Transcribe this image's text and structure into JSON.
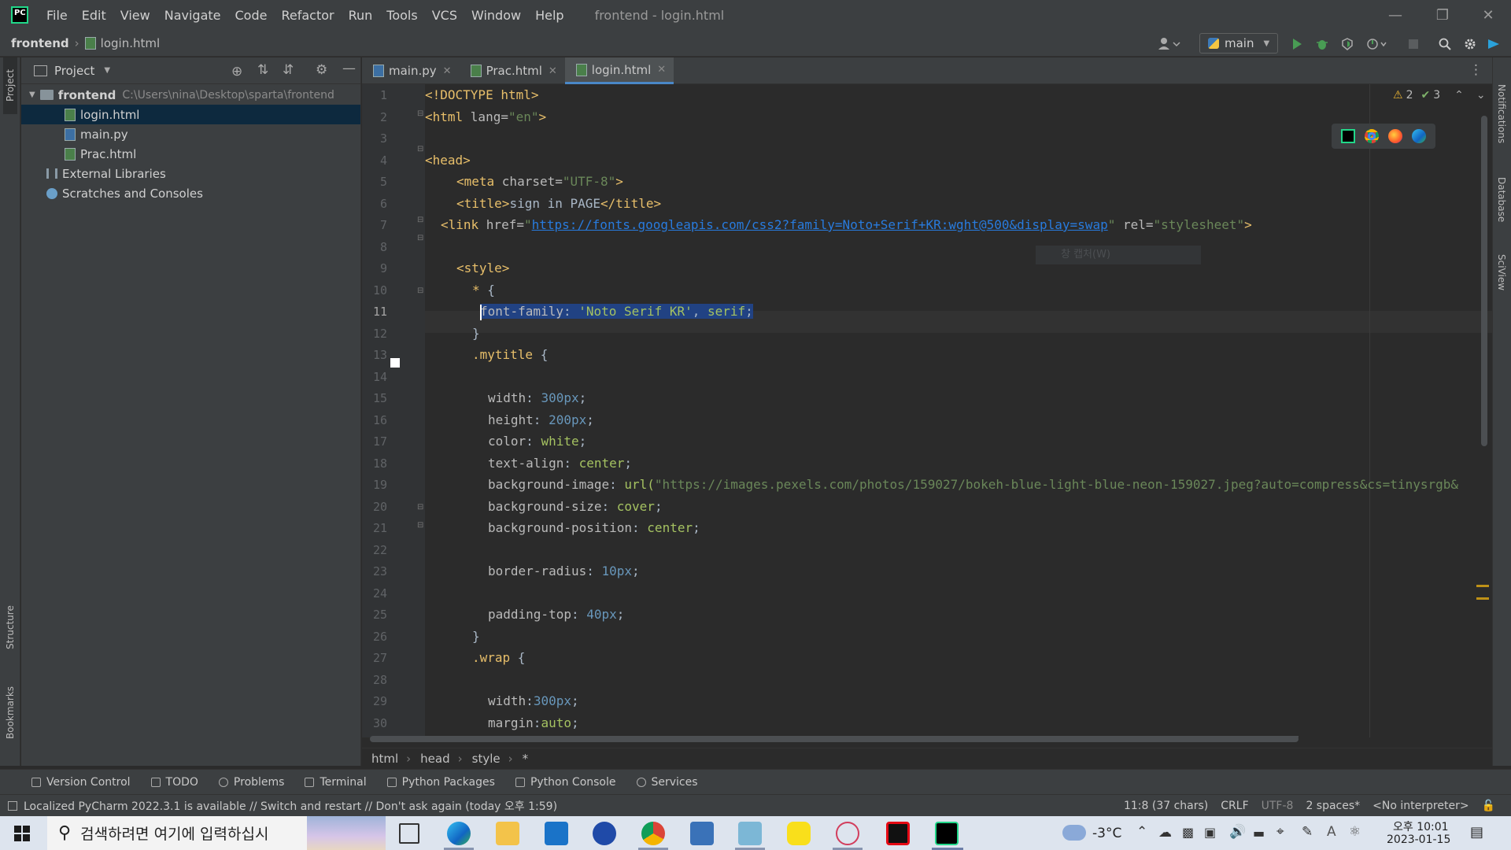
{
  "menubar": {
    "logo_text": "PC",
    "items": [
      "File",
      "Edit",
      "View",
      "Navigate",
      "Code",
      "Refactor",
      "Run",
      "Tools",
      "VCS",
      "Window",
      "Help"
    ],
    "window_title": "frontend - login.html"
  },
  "navbar": {
    "project": "frontend",
    "file": "login.html",
    "run_config": "main"
  },
  "project_panel": {
    "title": "Project",
    "tree": [
      {
        "label": "frontend",
        "hint": "C:\\Users\\nina\\Desktop\\sparta\\frontend",
        "type": "folder",
        "indent": 0
      },
      {
        "label": "login.html",
        "type": "html",
        "indent": 2
      },
      {
        "label": "main.py",
        "type": "py",
        "indent": 2
      },
      {
        "label": "Prac.html",
        "type": "html",
        "indent": 2
      },
      {
        "label": "External Libraries",
        "type": "lib",
        "indent": 1
      },
      {
        "label": "Scratches and Consoles",
        "type": "scratch",
        "indent": 1
      }
    ]
  },
  "tabs": [
    {
      "label": "main.py",
      "type": "py",
      "active": false
    },
    {
      "label": "Prac.html",
      "type": "html",
      "active": false
    },
    {
      "label": "login.html",
      "type": "html",
      "active": true
    }
  ],
  "editor": {
    "warnings": "2",
    "weak_warnings": "3",
    "current_line": 11,
    "line_numbers": [
      "1",
      "2",
      "3",
      "4",
      "5",
      "6",
      "7",
      "8",
      "9",
      "10",
      "11",
      "12",
      "13",
      "14",
      "15",
      "16",
      "17",
      "18",
      "19",
      "20",
      "21",
      "22",
      "23",
      "24",
      "25",
      "26",
      "27",
      "28",
      "29",
      "30"
    ],
    "overlay_hint": "창 캡처(W)"
  },
  "breadcrumbs": [
    "html",
    "head",
    "style",
    "*"
  ],
  "tool_windows": [
    "Version Control",
    "TODO",
    "Problems",
    "Terminal",
    "Python Packages",
    "Python Console",
    "Services"
  ],
  "left_strip": [
    "Project",
    "Structure",
    "Bookmarks"
  ],
  "right_strip": [
    "Notifications",
    "Database",
    "SciView"
  ],
  "status": {
    "message": "Localized PyCharm 2022.3.1 is available // Switch and restart // Don't ask again (today 오후 1:59)",
    "position": "11:8 (37 chars)",
    "line_sep": "CRLF",
    "encoding": "UTF-8",
    "indent": "2 spaces*",
    "interpreter": "<No interpreter>"
  },
  "taskbar": {
    "search_placeholder": "검색하려면 여기에 입력하십시",
    "weather": "-3°C",
    "time": "오후 10:01",
    "date": "2023-01-15"
  }
}
